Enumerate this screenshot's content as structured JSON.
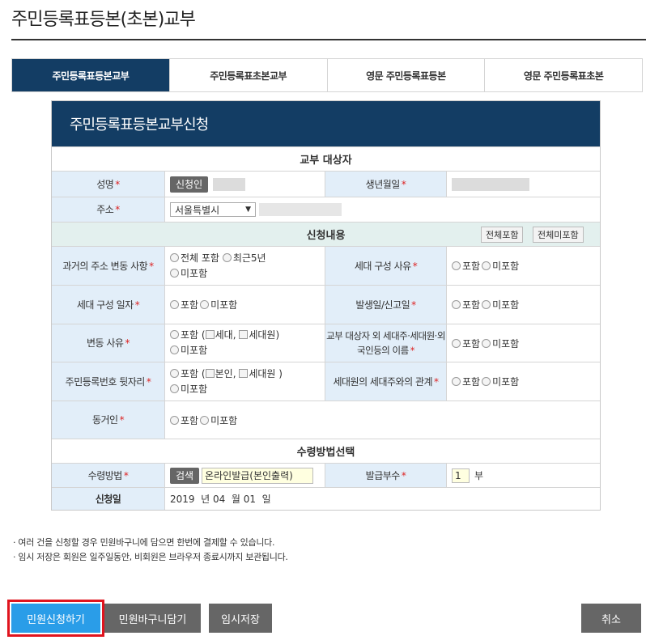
{
  "page": {
    "title": "주민등록표등본(초본)교부"
  },
  "tabs": [
    {
      "label": "주민등록표등본교부"
    },
    {
      "label": "주민등록표초본교부"
    },
    {
      "label": "영문 주민등록표등본"
    },
    {
      "label": "영문 주민등록표초본"
    }
  ],
  "form": {
    "title": "주민등록표등본교부신청",
    "section_target": "교부 대상자",
    "name_label": "성명",
    "applicant_btn": "신청인",
    "birth_label": "생년월일",
    "address_label": "주소",
    "address_select": "서울특별시",
    "section_content": "신청내용",
    "include_all_btn": "전체포함",
    "exclude_all_btn": "전체미포함",
    "past_addr_label": "과거의 주소 변동 사항",
    "past_opt_all": "전체 포함",
    "past_opt_recent": "최근5년",
    "opt_exclude": "미포함",
    "opt_include": "포함",
    "household_reason_label": "세대 구성 사유",
    "household_date_label": "세대 구성 일자",
    "issue_date_label": "발생일/신고일",
    "change_reason_label": "변동 사유",
    "chk_household": "세대",
    "chk_members": "세대원",
    "chk_self": "본인",
    "chk_members2": "세대원 )",
    "others_label": "교부 대상자 외 세대주·세대원·외국인등의 이름",
    "rrn_label": "주민등록번호 뒷자리",
    "relation_label": "세대원의 세대주와의 관계",
    "cohabitant_label": "동거인",
    "section_receive": "수령방법선택",
    "method_label": "수령방법",
    "search_btn": "검색",
    "method_value": "온라인발급(본인출력)",
    "copies_label": "발급부수",
    "copies_value": "1",
    "copies_unit": "부",
    "apply_date_label": "신청일",
    "apply_date_value": "2019  년 04  월 01  일"
  },
  "notes": [
    "여러 건을 신청할 경우 민원바구니에 담으면 한번에 결제할 수 있습니다.",
    "임시 저장은 회원은 일주일동안, 비회원은 브라우저 종료시까지 보관됩니다."
  ],
  "buttons": {
    "apply": "민원신청하기",
    "basket": "민원바구니담기",
    "temp_save": "임시저장",
    "cancel": "취소"
  },
  "colors": {
    "navy": "#133d64",
    "label_bg": "#e2eef9",
    "section_green": "#e3f0ee",
    "apply_blue": "#2a9de8",
    "highlight_red": "#e0141e"
  }
}
